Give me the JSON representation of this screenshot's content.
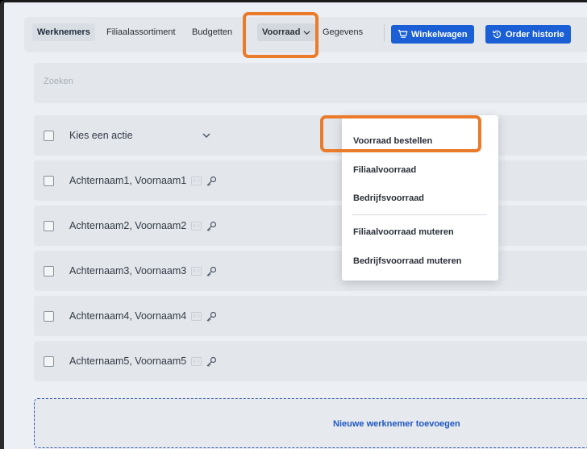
{
  "nav": {
    "items": [
      "Werknemers",
      "Filiaalassortiment",
      "Budgetten",
      "Voorraad",
      "Gegevens"
    ],
    "cart_label": "Winkelwagen",
    "history_label": "Order historie"
  },
  "search": {
    "placeholder": "Zoeken"
  },
  "bulk": {
    "label": "Kies een actie"
  },
  "employees": [
    "Achternaam1, Voornaam1",
    "Achternaam2, Voornaam2",
    "Achternaam3, Voornaam3",
    "Achternaam4, Voornaam4",
    "Achternaam5, Voornaam5"
  ],
  "add_employee": "Nieuwe werknemer toevoegen",
  "dropdown": {
    "items": [
      "Voorraad bestellen",
      "Filiaalvoorraad",
      "Bedrijfsvoorraad",
      "Filiaalvoorraad muteren",
      "Bedrijfsvoorraad muteren"
    ]
  },
  "colors": {
    "accent": "#1a5fd6",
    "highlight": "#ea7b2a"
  }
}
